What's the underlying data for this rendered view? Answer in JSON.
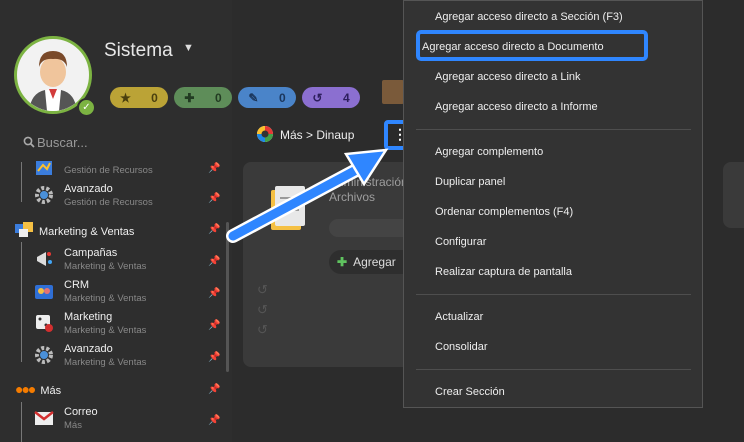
{
  "user": {
    "name": "Sistema",
    "badges": [
      {
        "icon": "star-icon",
        "value": "0",
        "bg": "#bba336",
        "fg": "#4a3f0e"
      },
      {
        "icon": "plus-icon",
        "value": "0",
        "bg": "#5e8d59",
        "fg": "#223b22"
      },
      {
        "icon": "pencil-icon",
        "value": "0",
        "bg": "#4a84c9",
        "fg": "#1b365c"
      },
      {
        "icon": "history-icon",
        "value": "4",
        "bg": "#8b6fd0",
        "fg": "#2d1e5c"
      }
    ]
  },
  "search": {
    "placeholder": "Buscar..."
  },
  "sidebar": {
    "items": [
      {
        "title": "",
        "subtitle": "Gestión de Recursos"
      },
      {
        "title": "Avanzado",
        "subtitle": "Gestión de Recursos"
      },
      {
        "section": "Marketing & Ventas"
      },
      {
        "title": "Campañas",
        "subtitle": "Marketing & Ventas"
      },
      {
        "title": "CRM",
        "subtitle": "Marketing & Ventas"
      },
      {
        "title": "Marketing",
        "subtitle": "Marketing & Ventas"
      },
      {
        "title": "Avanzado",
        "subtitle": "Marketing & Ventas"
      },
      {
        "section": "Más"
      },
      {
        "title": "Correo",
        "subtitle": "Más"
      }
    ]
  },
  "main": {
    "tab": "Más > Dinaup",
    "more_button": "⋮",
    "panel_title_1": "Administración",
    "panel_title_2": "Archivos",
    "add_button": "Agregar"
  },
  "menu": {
    "items": [
      "Agregar acceso directo a Sección (F3)",
      "Agregar acceso directo a Documento",
      "Agregar acceso directo a Link",
      "Agregar acceso directo a Informe",
      "Agregar complemento",
      "Duplicar panel",
      "Ordenar complementos (F4)",
      "Configurar",
      "Realizar captura de pantalla",
      "Actualizar",
      "Consolidar",
      "Crear Sección"
    ]
  },
  "colors": {
    "accent": "#2f86ff",
    "online": "#7cb342"
  }
}
